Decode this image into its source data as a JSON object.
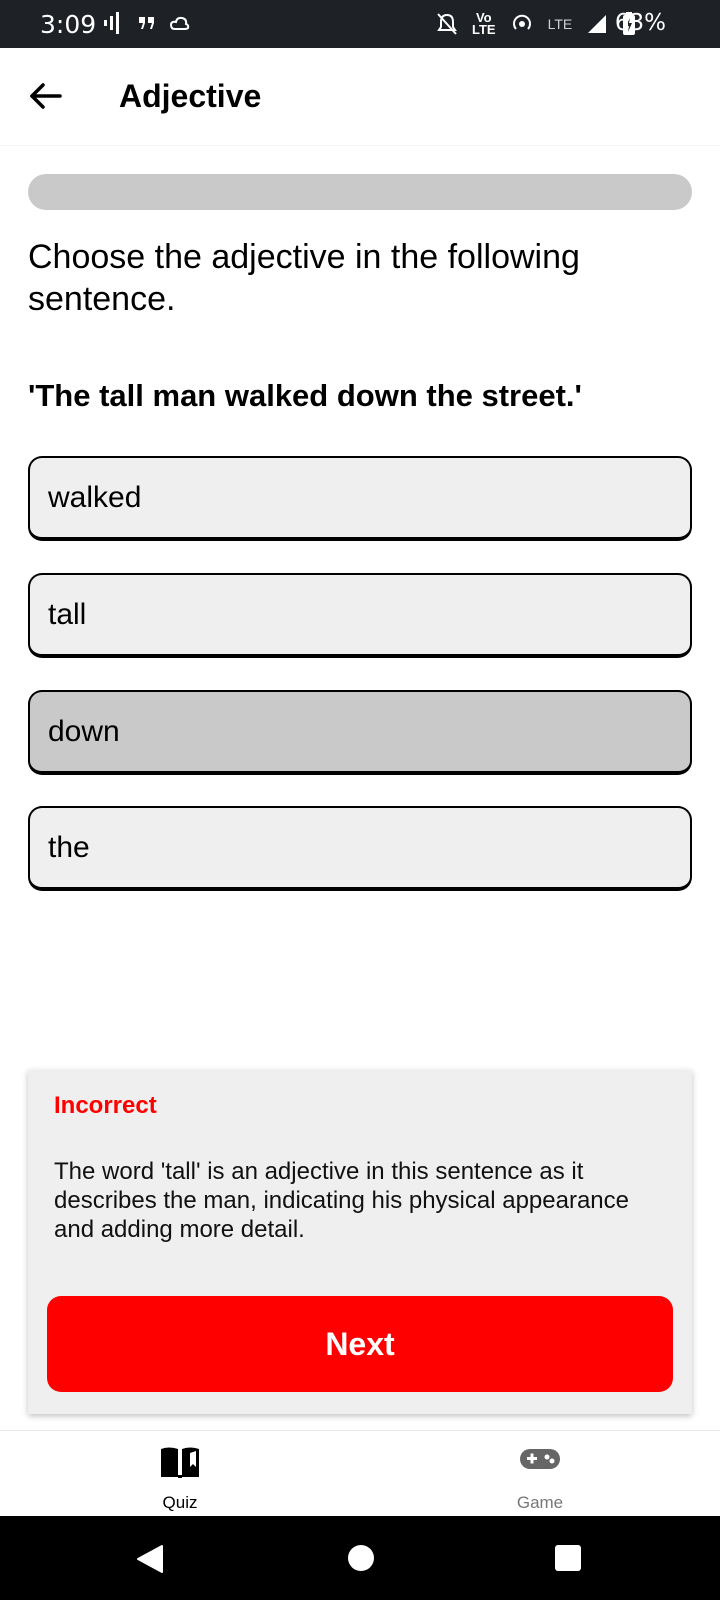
{
  "status_bar": {
    "time": "3:09",
    "network": "LTE",
    "volte_top": "Vo",
    "volte_bottom": "LTE",
    "battery": "63%"
  },
  "header": {
    "title": "Adjective"
  },
  "progress": {
    "fraction": 0.0
  },
  "question": {
    "prompt": "Choose the adjective in the following sentence.",
    "sentence": "'The tall man walked down the street.'"
  },
  "options": [
    {
      "label": "walked",
      "selected": false
    },
    {
      "label": "tall",
      "selected": false
    },
    {
      "label": "down",
      "selected": true
    },
    {
      "label": "the",
      "selected": false
    }
  ],
  "feedback": {
    "status": "Incorrect",
    "explanation": "The word 'tall' is an adjective in this sentence as it describes the man, indicating his physical appearance and adding more detail.",
    "next_label": "Next"
  },
  "bottom_nav": [
    {
      "label": "Quiz",
      "icon": "book-icon",
      "active": true
    },
    {
      "label": "Game",
      "icon": "gamepad-icon",
      "active": false
    }
  ],
  "colors": {
    "accent": "#ff0000",
    "option_bg": "#efefef",
    "option_selected_bg": "#c9c9c9",
    "status_bar_bg": "#1e2126"
  }
}
